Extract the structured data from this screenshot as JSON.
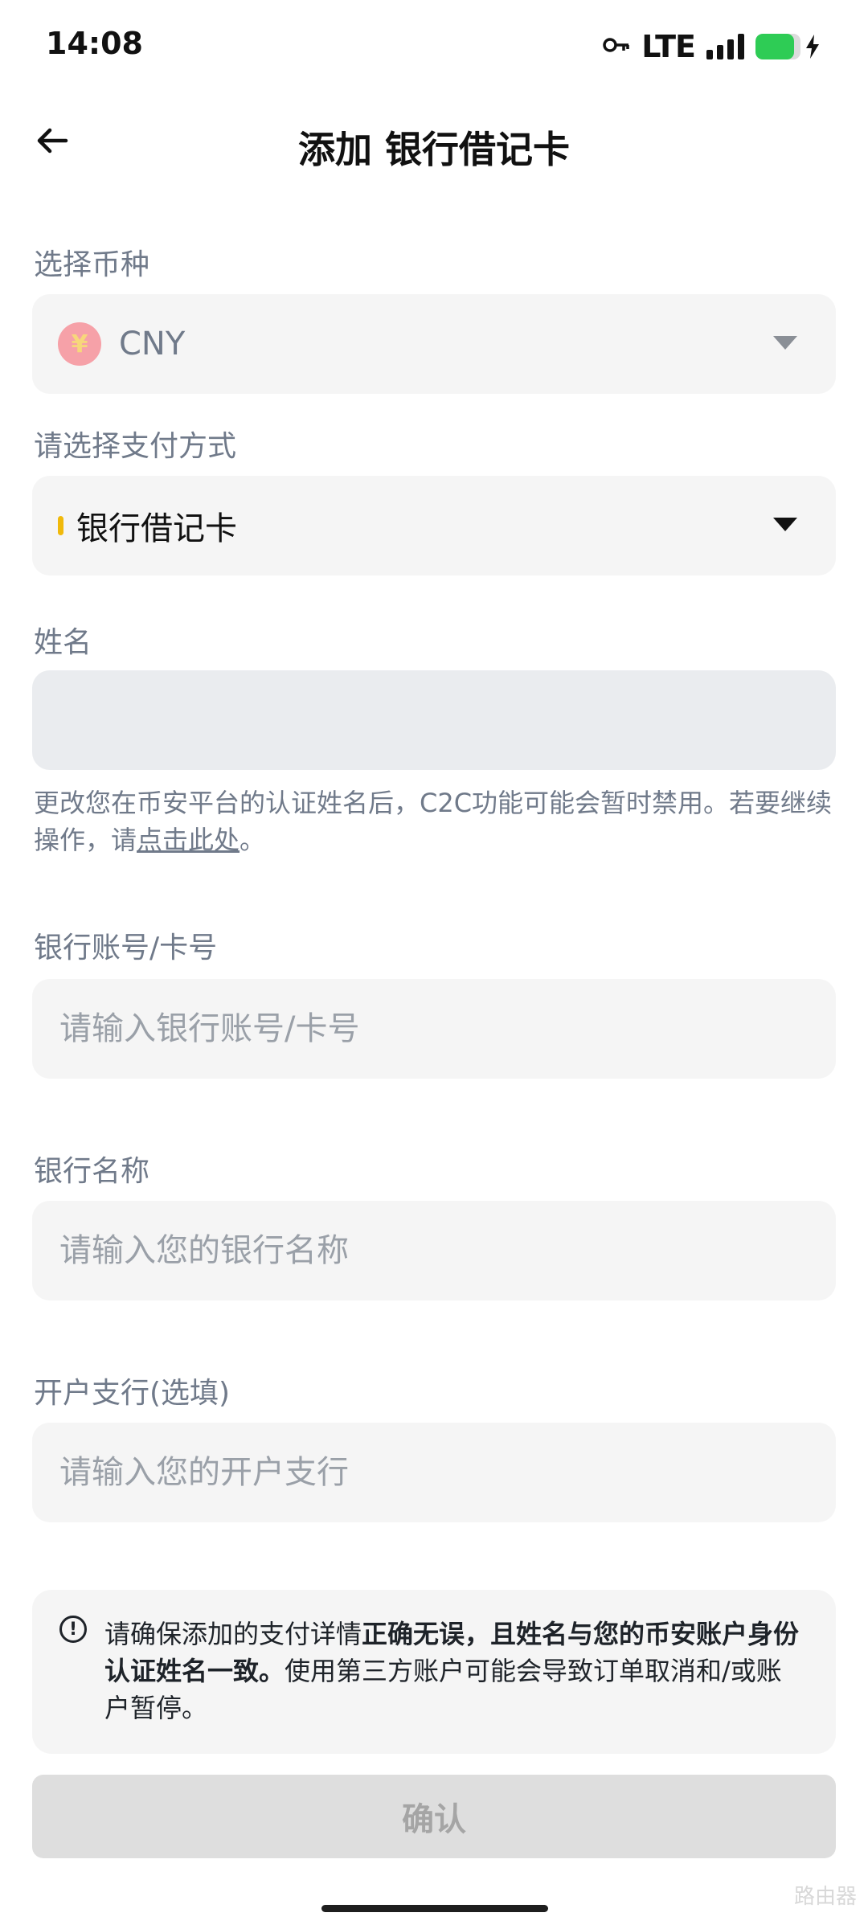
{
  "status_bar": {
    "time": "14:08",
    "network": "LTE",
    "signal_bars": 4,
    "battery_level": 0.85
  },
  "header": {
    "title": "添加 银行借记卡"
  },
  "currency": {
    "label": "选择币种",
    "value": "CNY",
    "icon_symbol": "¥"
  },
  "payment_method": {
    "label": "请选择支付方式",
    "value": "银行借记卡"
  },
  "name": {
    "label": "姓名",
    "value": "",
    "help_text": "更改您在币安平台的认证姓名后，C2C功能可能会暂时禁用。若要继续操作，请",
    "help_link": "点击此处",
    "help_suffix": "。"
  },
  "account_number": {
    "label": "银行账号/卡号",
    "placeholder": "请输入银行账号/卡号"
  },
  "bank_name": {
    "label": "银行名称",
    "placeholder": "请输入您的银行名称"
  },
  "branch": {
    "label": "开户支行(选填)",
    "placeholder": "请输入您的开户支行"
  },
  "notice": {
    "part1": "请确保添加的支付详情",
    "bold": "正确无误，且姓名与您的币安账户身份认证姓名一致。",
    "part2": "使用第三方账户可能会导致订单取消和/或账户暂停。"
  },
  "confirm_button": "确认",
  "watermark": "路由器",
  "colors": {
    "accent": "#F0B90B",
    "field_bg": "#F5F5F5",
    "label": "#707A8A",
    "button_disabled": "#DEDEDE"
  }
}
